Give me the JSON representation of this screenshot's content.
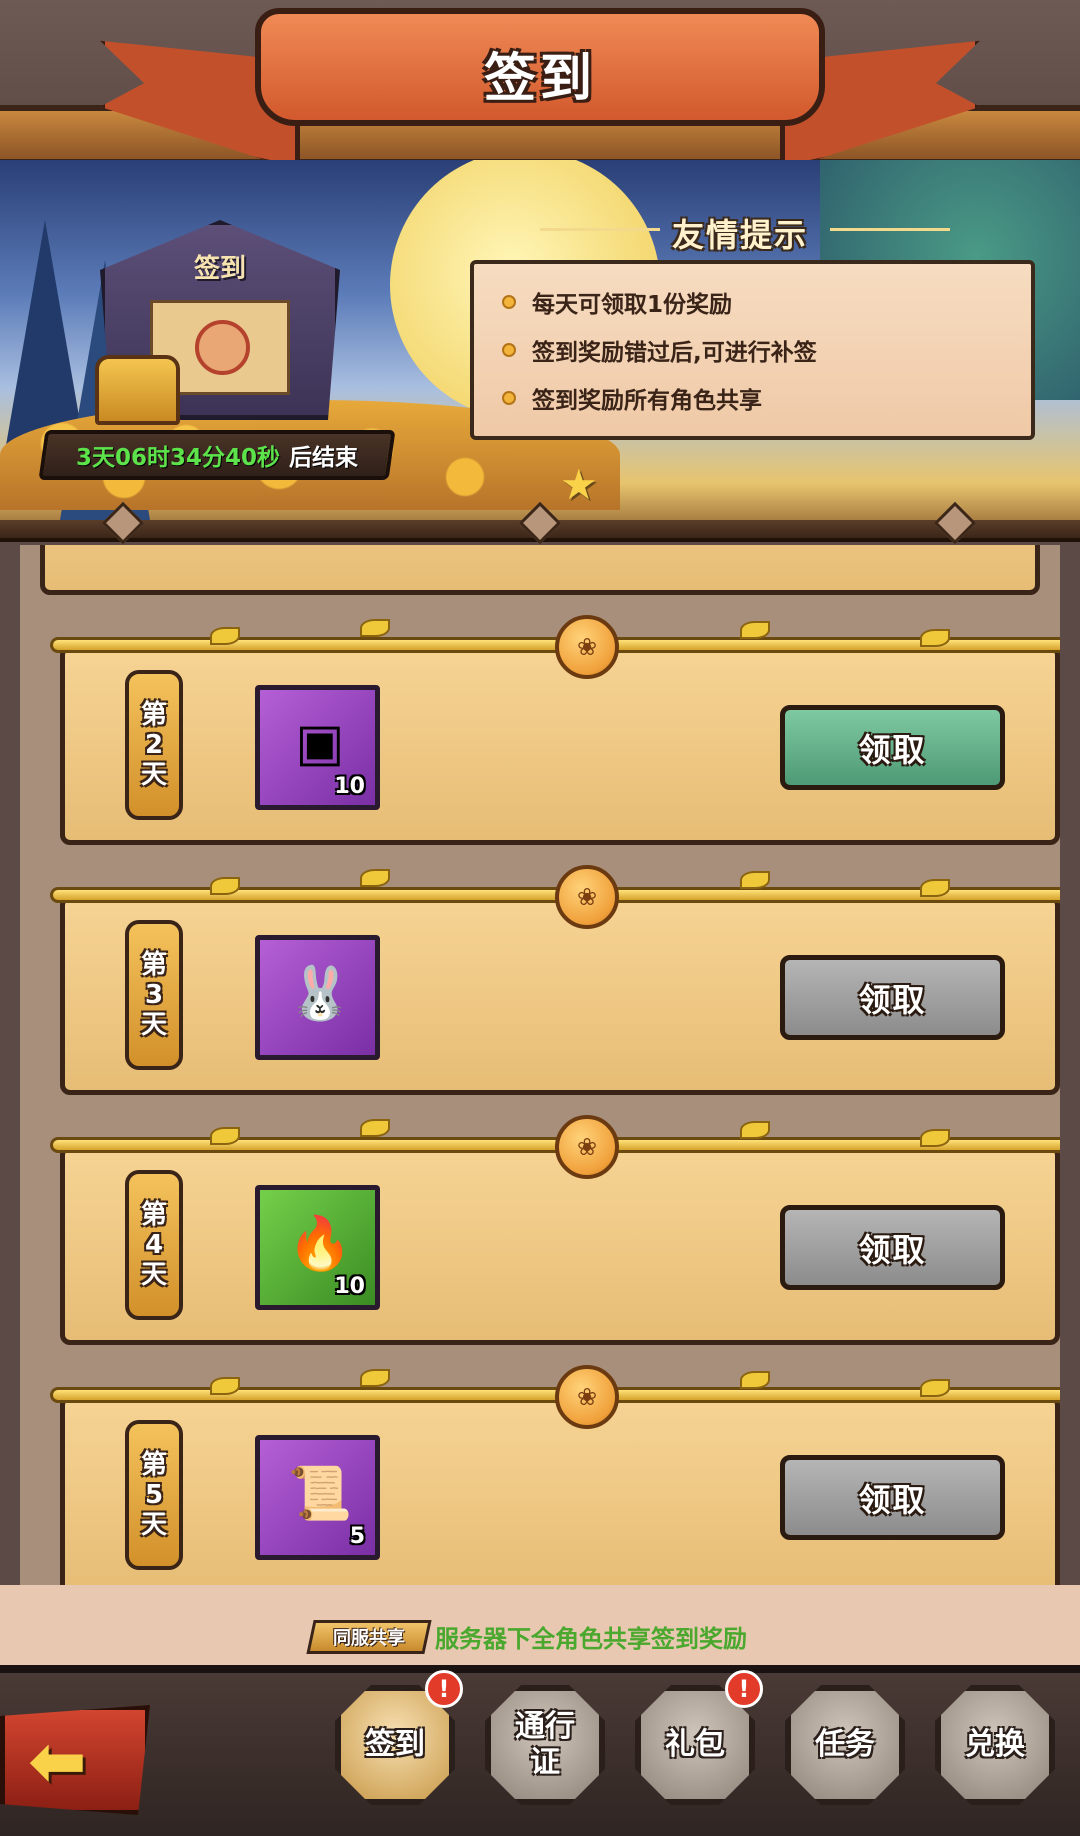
{
  "header": {
    "title": "签到"
  },
  "banner": {
    "board_label": "签到",
    "countdown": "3天06时34分40秒",
    "countdown_suffix": "后结束",
    "tips_title": "友情提示",
    "tips": [
      "每天可领取1份奖励",
      "签到奖励错过后,可进行补签",
      "签到奖励所有角色共享"
    ]
  },
  "days": [
    {
      "day": [
        "第",
        "2",
        "天"
      ],
      "reward_icon": "ticket-icon",
      "reward_glyph": "▣",
      "count": "10",
      "bg": "purple",
      "button": "领取",
      "state": "active"
    },
    {
      "day": [
        "第",
        "3",
        "天"
      ],
      "reward_icon": "bunny-character-icon",
      "reward_glyph": "🐰",
      "count": "",
      "bg": "purple",
      "button": "领取",
      "state": "disabled"
    },
    {
      "day": [
        "第",
        "4",
        "天"
      ],
      "reward_icon": "blue-flame-icon",
      "reward_glyph": "🔥",
      "count": "10",
      "bg": "green",
      "button": "领取",
      "state": "disabled"
    },
    {
      "day": [
        "第",
        "5",
        "天"
      ],
      "reward_icon": "scroll-icon",
      "reward_glyph": "📜",
      "count": "5",
      "bg": "purple",
      "button": "领取",
      "state": "disabled"
    }
  ],
  "footer": {
    "share_badge": "同服共享",
    "share_text": "服务器下全角色共享签到奖励",
    "nav": [
      {
        "label": "签到",
        "alert": "!"
      },
      {
        "label": "通行证",
        "alert": ""
      },
      {
        "label": "礼包",
        "alert": "!"
      },
      {
        "label": "任务",
        "alert": ""
      },
      {
        "label": "兑换",
        "alert": ""
      }
    ]
  },
  "colors": {
    "claim_active": "#5fae86",
    "claim_disabled": "#a3a3a3",
    "timer_green": "#5de24b",
    "share_green": "#4aa82e"
  }
}
